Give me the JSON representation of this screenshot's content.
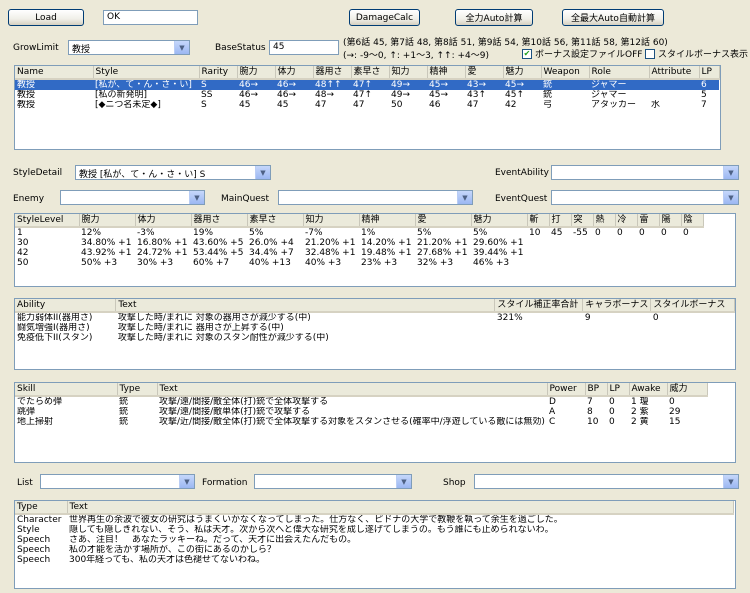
{
  "toolbar": {
    "load_label": "Load",
    "name_value": "OK",
    "damage_label": "DamageCalc",
    "full_power_label": "全力Auto計算",
    "max_auto_label": "全最大Auto自動計算"
  },
  "grow": {
    "label": "GrowLimit",
    "value": "教授",
    "base_label": "BaseStatus",
    "base_value": "45",
    "episodes": "(第6話 45, 第7話 48, 第8話 51, 第9話 54, 第10話 56, 第11話 58, 第12話 60)",
    "arrows": "(→: -9〜0, ↑: +1〜3, ↑↑: +4〜9)",
    "bonus_off_label": "ボーナス設定ファイルOFF",
    "style_bonus_label": "スタイルボーナス表示"
  },
  "style_table": {
    "headers": [
      "Name",
      "Style",
      "Rarity",
      "腕力",
      "体力",
      "器用さ",
      "素早さ",
      "知力",
      "精神",
      "愛",
      "魅力",
      "Weapon",
      "Role",
      "Attribute",
      "LP"
    ],
    "rows": [
      [
        "教授",
        "[私が、て・ん・さ・い]",
        "S",
        "46→",
        "46→",
        "48↑↑",
        "47↑",
        "49→",
        "45→",
        "43→",
        "45→",
        "銃",
        "ジャマー",
        "",
        "6"
      ],
      [
        "教授",
        "[私の新発明]",
        "SS",
        "46→",
        "46→",
        "48→",
        "47↑",
        "49→",
        "45→",
        "43↑",
        "45↑",
        "銃",
        "ジャマー",
        "",
        "5"
      ],
      [
        "教授",
        "[◆ニつ名未定◆]",
        "S",
        "45",
        "45",
        "47",
        "47",
        "50",
        "46",
        "47",
        "42",
        "弓",
        "アタッカー",
        "水",
        "7"
      ]
    ]
  },
  "filters": {
    "style_detail_label": "StyleDetail",
    "style_detail_value": "教授 [私が、て・ん・さ・い] S",
    "event_ability_label": "EventAbility",
    "enemy_label": "Enemy",
    "main_quest_label": "MainQuest",
    "event_quest_label": "EventQuest"
  },
  "level_table": {
    "headers": [
      "StyleLevel",
      "腕力",
      "体力",
      "器用さ",
      "素早さ",
      "知力",
      "精神",
      "愛",
      "魅力"
    ],
    "rows": [
      [
        "1",
        "12%",
        "-3%",
        "19%",
        "5%",
        "-7%",
        "1%",
        "5%",
        "5%"
      ],
      [
        "30",
        "34.80% +1",
        "16.80% +1",
        "43.60% +5",
        "26.0% +4",
        "21.20% +1",
        "14.20% +1",
        "21.20% +1",
        "29.60% +1"
      ],
      [
        "42",
        "43.92% +1",
        "24.72% +1",
        "53.44% +5",
        "34.4% +7",
        "32.48% +1",
        "19.48% +1",
        "27.68% +1",
        "39.44% +1"
      ],
      [
        "50",
        "50% +3",
        "30% +3",
        "60% +7",
        "40% +13",
        "40% +3",
        "23% +3",
        "32% +3",
        "46% +3"
      ]
    ],
    "res_headers": [
      "斬",
      "打",
      "突",
      "熱",
      "冷",
      "雷",
      "陽",
      "陰"
    ],
    "res_values": [
      "10",
      "45",
      "-55",
      "0",
      "0",
      "0",
      "0",
      "0"
    ]
  },
  "ability_table": {
    "headers": [
      "Ability",
      "Text",
      "スタイル補正率合計",
      "キャラボーナス",
      "スタイルボーナス"
    ],
    "rows": [
      [
        "能力弱体II(器用さ)",
        "攻撃した時/まれに 対象の器用さが減少する(中)",
        "321%",
        "9",
        "0"
      ],
      [
        "闘気増強I(器用さ)",
        "攻撃した時/まれに 器用さが上昇する(中)",
        "",
        "",
        ""
      ],
      [
        "免疫低下II(スタン)",
        "攻撃した時/まれに 対象のスタン耐性が減少する(中)",
        "",
        "",
        ""
      ]
    ]
  },
  "skill_table": {
    "headers": [
      "Skill",
      "Type",
      "Text",
      "Power",
      "BP",
      "LP",
      "Awake",
      "威力"
    ],
    "rows": [
      [
        "でたらめ弾",
        "銃",
        "攻撃/遠/間接/敵全体(打)銃で全体攻撃する",
        "D",
        "7",
        "0",
        "1 瓊",
        "0"
      ],
      [
        "跳弾",
        "銃",
        "攻撃/遠/間接/敵単体(打)銃で攻撃する",
        "A",
        "8",
        "0",
        "2 紫",
        "29"
      ],
      [
        "地上掃射",
        "銃",
        "攻撃/近/間接/敵全体(打)銃で全体攻撃する対象をスタンさせる(確率中/浮遊している敵には無効)",
        "C",
        "10",
        "0",
        "2 黄",
        "15"
      ]
    ]
  },
  "bottom": {
    "list_label": "List",
    "formation_label": "Formation",
    "shop_label": "Shop"
  },
  "text_table": {
    "headers": [
      "Type",
      "Text"
    ],
    "rows": [
      [
        "Character",
        "世界再生の余波で彼女の研究はうまくいかなくなってしまった。仕方なく、ピドナの大学で教鞭を執って余生を過ごした。"
      ],
      [
        "Style",
        "隠しても隠しきれない、そう、私は天才。次から次へと偉大な研究を成し遂げてしまうの。もう誰にも止められないわ。"
      ],
      [
        "Speech",
        "さあ、注目！　あなたラッキーね。だって、天才に出会えたんだもの。"
      ],
      [
        "Speech",
        "私の才能を活かす場所が、この街にあるのかしら？"
      ],
      [
        "Speech",
        "300年経っても、私の天才は色褪せてないわね。"
      ]
    ]
  }
}
